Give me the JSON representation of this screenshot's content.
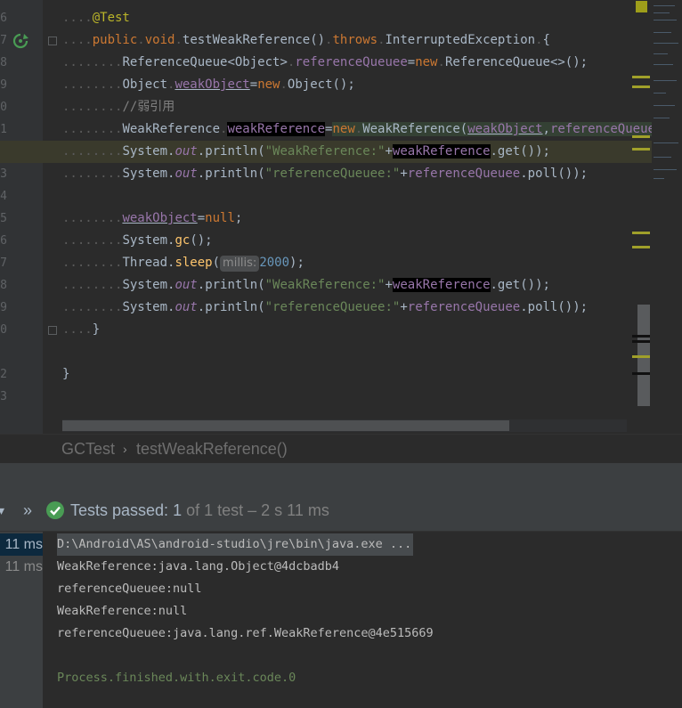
{
  "gutter": {
    "line_numbers": [
      "6",
      "7",
      "8",
      "9",
      "0",
      "1",
      "2",
      "3",
      "4",
      "5",
      "6",
      "7",
      "8",
      "9",
      "0",
      "1",
      "2",
      "3"
    ]
  },
  "code": {
    "annotation": "@Test",
    "kw_public": "public",
    "kw_void": "void",
    "method_name": "testWeakReference",
    "kw_throws": "throws",
    "exception": "InterruptedException",
    "type_reference_queue": "ReferenceQueue",
    "generic_object": "<Object>",
    "var_reference_queue": "referenceQueuee",
    "kw_new": "new",
    "ctor_reference_queue": "ReferenceQueue<>()",
    "type_object": "Object",
    "var_weak_object": "weakObject",
    "ctor_object": "Object()",
    "comment": "//弱引用",
    "type_weak_reference": "WeakReference",
    "var_weak_reference": "weakReference",
    "ctor_weak_reference": "WeakReference(",
    "system": "System",
    "out": "out",
    "println": "println(",
    "str_weak_reference": "\"WeakReference:\"",
    "str_reference_queue": "\"referenceQueuee:\"",
    "get_call": ".get());",
    "poll_call": ".poll());",
    "null_literal": "null",
    "gc_call": "gc",
    "thread": "Thread",
    "sleep_call": "sleep",
    "param_hint": "millis:",
    "sleep_value": "2000",
    "close_brace": "}"
  },
  "breadcrumb": {
    "class_name": "GCTest",
    "separator": "›",
    "method": "testWeakReference()"
  },
  "run_panel": {
    "status_prefix": "Tests passed: ",
    "passed_count": "1",
    "of_word": " of ",
    "total_count": "1",
    "test_word": " test",
    "duration": " – 2 s 11 ms",
    "times": [
      "11 ms",
      "11 ms"
    ],
    "console_lines": [
      "D:\\Android\\AS\\android-studio\\jre\\bin\\java.exe ...",
      "WeakReference:java.lang.Object@4dcbadb4",
      "referenceQueuee:null",
      "WeakReference:null",
      "referenceQueuee:java.lang.ref.WeakReference@4e515669",
      "",
      "Process.finished.with.exit.code.0"
    ]
  },
  "colors": {
    "background": "#2b2b2b",
    "keyword": "#cc7832",
    "string": "#6a8759",
    "field": "#9876aa",
    "annotation": "#bbb529",
    "pass_green": "#499c54"
  }
}
